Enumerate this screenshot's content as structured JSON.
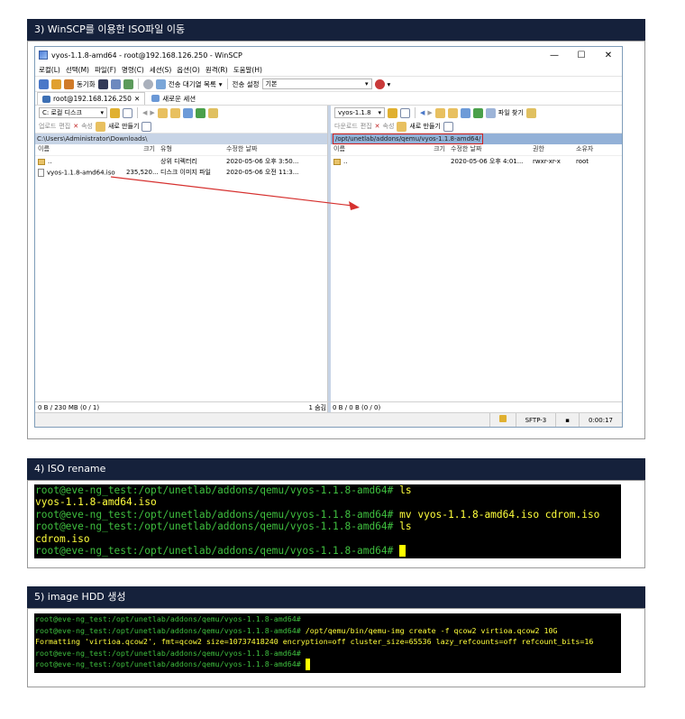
{
  "sections": [
    {
      "title": "3) WinSCP를 이용한 ISO파일 이동"
    },
    {
      "title": "4) ISO rename"
    },
    {
      "title": "5) image HDD 생성"
    }
  ],
  "winscp": {
    "title": "vyos-1.1.8-amd64 - root@192.168.126.250 - WinSCP",
    "window_buttons": [
      "—",
      "☐",
      "✕"
    ],
    "menu": [
      "로컬(L)",
      "선택(M)",
      "파일(F)",
      "명령(C)",
      "세션(S)",
      "옵션(O)",
      "원격(R)",
      "도움말(H)"
    ],
    "toolbar": {
      "sync_label": "동기화",
      "queue_label": "전송 대기열 목록",
      "transfer_settings_label": "전송 설정",
      "transfer_settings_value": "기본"
    },
    "tabs": [
      {
        "label": "root@192.168.126.250"
      },
      {
        "label": "새로운 세션"
      }
    ],
    "left": {
      "drive": "C: 로컬 디스크",
      "upload_label": "업로드",
      "edit_label": "편집",
      "props_label": "속성",
      "new_label": "새로 만들기",
      "path": "C:\\Users\\Administrator\\Downloads\\",
      "columns": [
        "이름",
        "크기",
        "유형",
        "수정한 날짜"
      ],
      "rows": [
        {
          "name": "..",
          "size": "",
          "type": "상위 디렉터리",
          "date": "2020-05-06  오후 3:50..."
        },
        {
          "name": "vyos-1.1.8-amd64.iso",
          "size": "235,520...",
          "type": "디스크 이미지 파일",
          "date": "2020-05-06  오전 11:3..."
        }
      ],
      "status": "0 B / 230 MB (0 / 1)",
      "hidden": "1 숨김"
    },
    "right": {
      "drive": "vyos-1.1.8",
      "download_label": "다운로드",
      "edit_label": "편집",
      "props_label": "속성",
      "new_label": "새로 만들기",
      "find_label": "파일 찾기",
      "path": "/opt/unetlab/addons/qemu/vyos-1.1.8-amd64/",
      "columns": [
        "이름",
        "크기",
        "수정한 날짜",
        "권한",
        "소유자"
      ],
      "rows": [
        {
          "name": "..",
          "size": "",
          "date": "2020-05-06  오후 4:01...",
          "perm": "rwxr-xr-x",
          "owner": "root"
        }
      ],
      "status": "0 B / 0 B (0 / 0)"
    },
    "bottom": {
      "protocol": "SFTP-3",
      "time": "0:00:17"
    },
    "arrow_color": "#d6312f"
  },
  "term1": [
    {
      "prompt": "root@eve-ng_test:/opt/unetlab/addons/qemu/vyos-1.1.8-amd64#",
      "cmd": " ls"
    },
    {
      "out": "vyos-1.1.8-amd64.iso"
    },
    {
      "prompt": "root@eve-ng_test:/opt/unetlab/addons/qemu/vyos-1.1.8-amd64#",
      "cmd": " mv vyos-1.1.8-amd64.iso cdrom.iso"
    },
    {
      "prompt": "root@eve-ng_test:/opt/unetlab/addons/qemu/vyos-1.1.8-amd64#",
      "cmd": " ls"
    },
    {
      "out": "cdrom.iso"
    },
    {
      "prompt": "root@eve-ng_test:/opt/unetlab/addons/qemu/vyos-1.1.8-amd64#",
      "cmd": " ",
      "cursor": true
    }
  ],
  "term2": [
    {
      "prompt": "root@eve-ng_test:/opt/unetlab/addons/qemu/vyos-1.1.8-amd64#",
      "cmd": ""
    },
    {
      "prompt": "root@eve-ng_test:/opt/unetlab/addons/qemu/vyos-1.1.8-amd64#",
      "cmd": " /opt/qemu/bin/qemu-img create -f qcow2 virtioa.qcow2 10G"
    },
    {
      "out": "Formatting 'virtioa.qcow2', fmt=qcow2 size=10737418240 encryption=off cluster_size=65536 lazy_refcounts=off refcount_bits=16"
    },
    {
      "prompt": "root@eve-ng_test:/opt/unetlab/addons/qemu/vyos-1.1.8-amd64#",
      "cmd": ""
    },
    {
      "prompt": "root@eve-ng_test:/opt/unetlab/addons/qemu/vyos-1.1.8-amd64#",
      "cmd": " ",
      "cursor": true
    }
  ]
}
